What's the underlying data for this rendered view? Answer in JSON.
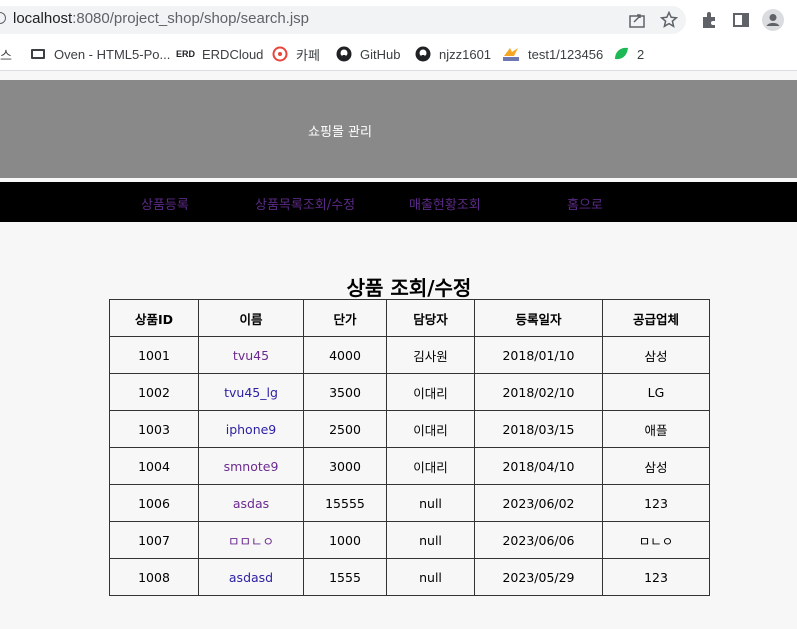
{
  "browser": {
    "url_host": "localhost",
    "url_rest": ":8080/project_shop/shop/search.jsp",
    "bookmarks": [
      {
        "label": "스",
        "icon": "partial-bookmark"
      },
      {
        "label": "Oven - HTML5-Po...",
        "icon": "oven-icon"
      },
      {
        "label": "ERDCloud",
        "icon": "erd-icon"
      },
      {
        "label": "카페",
        "icon": "cafe-icon"
      },
      {
        "label": "GitHub",
        "icon": "github-icon"
      },
      {
        "label": "njzz1601",
        "icon": "github-icon"
      },
      {
        "label": "test1/123456",
        "icon": "pma-icon"
      },
      {
        "label": "2",
        "icon": "green-leaf-icon"
      }
    ]
  },
  "header": {
    "title": "쇼핑몰 관리"
  },
  "nav": {
    "items": [
      "상품등록",
      "상품목록조회/수정",
      "매출현황조회",
      "홈으로"
    ]
  },
  "main": {
    "title": "상품 조회/수정",
    "columns": [
      "상품ID",
      "이름",
      "단가",
      "담당자",
      "등록일자",
      "공급업체"
    ],
    "rows": [
      {
        "id": "1001",
        "name": "tvu45",
        "price": "4000",
        "manager": "김사원",
        "date": "2018/01/10",
        "supplier": "삼성"
      },
      {
        "id": "1002",
        "name": "tvu45_lg",
        "price": "3500",
        "manager": "이대리",
        "date": "2018/02/10",
        "supplier": "LG"
      },
      {
        "id": "1003",
        "name": "iphone9",
        "price": "2500",
        "manager": "이대리",
        "date": "2018/03/15",
        "supplier": "애플"
      },
      {
        "id": "1004",
        "name": "smnote9",
        "price": "3000",
        "manager": "이대리",
        "date": "2018/04/10",
        "supplier": "삼성"
      },
      {
        "id": "1006",
        "name": "asdas",
        "price": "15555",
        "manager": "null",
        "date": "2023/06/02",
        "supplier": "123"
      },
      {
        "id": "1007",
        "name": "ㅁㅁㄴㅇ",
        "price": "1000",
        "manager": "null",
        "date": "2023/06/06",
        "supplier": "ㅁㄴㅇ"
      },
      {
        "id": "1008",
        "name": "asdasd",
        "price": "1555",
        "manager": "null",
        "date": "2023/05/29",
        "supplier": "123"
      }
    ]
  },
  "colors": {
    "header_bg": "#898989",
    "nav_bg": "#000000",
    "nav_link": "#5b2a86",
    "link": "#2b1fa3"
  }
}
